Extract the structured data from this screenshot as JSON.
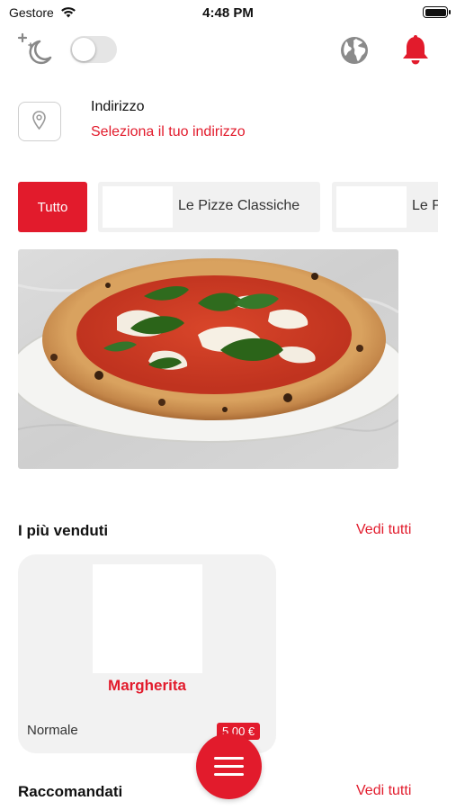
{
  "status_bar": {
    "carrier": "Gestore",
    "time": "4:48 PM"
  },
  "header": {
    "moon_icon": "moon-stars-icon",
    "theme_toggle_on": false,
    "globe_icon": "globe-icon",
    "bell_icon": "bell-icon"
  },
  "address": {
    "icon": "location-pin-icon",
    "title": "Indirizzo",
    "subtitle": "Seleziona il tuo indirizzo"
  },
  "categories": {
    "all_label": "Tutto",
    "items": [
      {
        "label": "Le Pizze Classiche"
      },
      {
        "label": "Le Pizze Speciali"
      }
    ]
  },
  "best_sellers": {
    "title": "I più venduti",
    "see_all": "Vedi tutti",
    "products": [
      {
        "name": "Margherita",
        "size": "Normale",
        "price": "5,00 €"
      }
    ]
  },
  "recommended": {
    "title": "Raccomandati",
    "see_all": "Vedi tutti"
  },
  "fab_icon": "menu-icon",
  "colors": {
    "accent": "#e21b2c",
    "card_bg": "#f2f2f2",
    "tab_bg": "#f1f1f1"
  }
}
